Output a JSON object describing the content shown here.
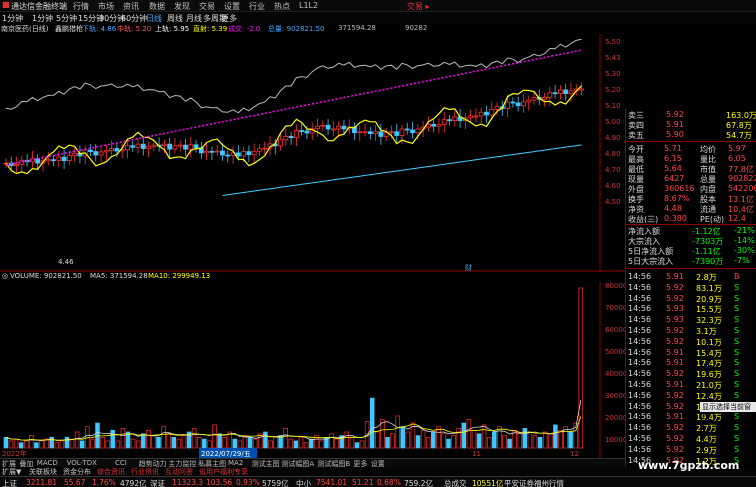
{
  "app": {
    "title": "通达信金融终端",
    "menus": [
      "行情",
      "市场",
      "资讯",
      "数据",
      "发现",
      "交易",
      "设置",
      "行业",
      "热点",
      "L1L2"
    ],
    "trade_label": "交易 ▸"
  },
  "periods": [
    "1分钟",
    "1分钟",
    "5分钟",
    "15分钟",
    "30分钟",
    "60分钟",
    "日线",
    "周线",
    "月线",
    "多周期",
    "更多"
  ],
  "active_period": "日线",
  "stock_info": {
    "name_label": "南京医药(日线)",
    "indicator": "鑫鹏猎枪",
    "down_label": "下轨: 4.86",
    "mid_label": "中轨: 5.20",
    "up_label": "上轨: 5.95",
    "price_label": "直射: 5.39",
    "ratio_label": "成交: -2.0",
    "vol_label": "总量: 902821.50",
    "ma5_label": "371594.28",
    "ma10_label": "90282"
  },
  "main_chart": {
    "price_ticks": [
      "5.50",
      "5.43",
      "5.30",
      "5.20",
      "5.10",
      "5.00",
      "4.90",
      "4.80",
      "4.70",
      "4.60",
      "4.50"
    ],
    "low_marker": "4.46",
    "flag_marker": "财"
  },
  "volume_info": {
    "label": "VOLUME: 902821.50",
    "ma5": "MA5: 371594.28",
    "ma10": "MA10: 299949.13"
  },
  "volume_ticks": [
    "80000",
    "70000",
    "60000",
    "50000",
    "40000",
    "30000",
    "20000",
    "10000"
  ],
  "date_labels": {
    "year": "2022年",
    "date": "2022/07/29/五",
    "month_a": "11",
    "month_b": "12"
  },
  "chart_data": {
    "type": "bar",
    "title": "",
    "series": [
      {
        "name": "VOLUME",
        "values": [
          6,
          4,
          5,
          3,
          4,
          7,
          3,
          4,
          5,
          6,
          3,
          4,
          6,
          5,
          9,
          4,
          12,
          5,
          14,
          6,
          4,
          10,
          4,
          11,
          9,
          5,
          4,
          8,
          10,
          7,
          6,
          12,
          8,
          6,
          5,
          7,
          9,
          11,
          6,
          5,
          4,
          13,
          8,
          6,
          9,
          5,
          4,
          7,
          6,
          5,
          8,
          9,
          4,
          6,
          7,
          11,
          5,
          4,
          6,
          3,
          5,
          7,
          4,
          6,
          8,
          5,
          7,
          9,
          6,
          3,
          4,
          15,
          28,
          9,
          16,
          6,
          8,
          18,
          12,
          9,
          14,
          7,
          10,
          6,
          9,
          12,
          8,
          5,
          7,
          11,
          14,
          16,
          10,
          8,
          13,
          6,
          9,
          12,
          7,
          5,
          10,
          8,
          11,
          9,
          7,
          6,
          9,
          8,
          13,
          10,
          12,
          9,
          14,
          90
        ]
      }
    ],
    "ylim": [
      0,
      90000
    ]
  },
  "order_book": [
    {
      "label": "卖三",
      "price": "5.92",
      "vol": "163.0万"
    },
    {
      "label": "卖四",
      "price": "5.91",
      "vol": "67.8万"
    },
    {
      "label": "卖五",
      "price": "5.90",
      "vol": "54.7万"
    }
  ],
  "quote_table": [
    {
      "l1": "今开",
      "v1": "5.71",
      "l2": "均价",
      "v2": "5.97"
    },
    {
      "l1": "最高",
      "v1": "6.15",
      "l2": "量比",
      "v2": "6.05"
    },
    {
      "l1": "最低",
      "v1": "5.64",
      "l2": "市值",
      "v2": "77.8亿"
    },
    {
      "l1": "现量",
      "v1": "6427",
      "l2": "总量",
      "v2": "902822"
    },
    {
      "l1": "外盘",
      "v1": "360616",
      "l2": "内盘",
      "v2": "542206"
    },
    {
      "l1": "换手",
      "v1": "8.67%",
      "l2": "股本",
      "v2": "13.1亿"
    },
    {
      "l1": "净资",
      "v1": "4.48",
      "l2": "流通",
      "v2": "10.4亿"
    },
    {
      "l1": "收益(三)",
      "v1": "0.380",
      "l2": "PE(动)",
      "v2": "12.4"
    }
  ],
  "fund_flow": [
    {
      "label": "净流入额",
      "value": "-1.12亿",
      "pct": "-21%"
    },
    {
      "label": "大宗流入",
      "value": "-7303万",
      "pct": "-14%"
    },
    {
      "label": "5日净流入额",
      "value": "-1.11亿",
      "pct": "-30%"
    },
    {
      "label": "5日大宗流入",
      "value": "-7390万",
      "pct": "-7%"
    }
  ],
  "ticks": [
    {
      "time": "14:56",
      "price": "5.91",
      "vol": "2.8万",
      "dir": "B"
    },
    {
      "time": "14:56",
      "price": "5.92",
      "vol": "83.1万",
      "dir": "S"
    },
    {
      "time": "14:56",
      "price": "5.92",
      "vol": "20.9万",
      "dir": "S"
    },
    {
      "time": "14:56",
      "price": "5.93",
      "vol": "15.5万",
      "dir": "S"
    },
    {
      "time": "14:56",
      "price": "5.93",
      "vol": "32.3万",
      "dir": "S"
    },
    {
      "time": "14:56",
      "price": "5.92",
      "vol": "3.1万",
      "dir": "S"
    },
    {
      "time": "14:56",
      "price": "5.92",
      "vol": "10.1万",
      "dir": "S"
    },
    {
      "time": "14:56",
      "price": "5.91",
      "vol": "15.4万",
      "dir": "S"
    },
    {
      "time": "14:56",
      "price": "5.91",
      "vol": "17.4万",
      "dir": "S"
    },
    {
      "time": "14:56",
      "price": "5.92",
      "vol": "19.6万",
      "dir": "S"
    },
    {
      "time": "14:56",
      "price": "5.91",
      "vol": "21.0万",
      "dir": "S"
    },
    {
      "time": "14:56",
      "price": "5.92",
      "vol": "12.4万",
      "dir": "S"
    },
    {
      "time": "14:56",
      "price": "5.92",
      "vol": "17.7万",
      "dir": "S"
    },
    {
      "time": "14:56",
      "price": "5.91",
      "vol": "19.4万",
      "dir": "S"
    },
    {
      "time": "14:56",
      "price": "5.92",
      "vol": "2.7万",
      "dir": "S"
    },
    {
      "time": "14:56",
      "price": "5.92",
      "vol": "4.4万",
      "dir": "S"
    },
    {
      "time": "14:56",
      "price": "5.92",
      "vol": "2.9万",
      "dir": "S"
    },
    {
      "time": "14:56",
      "price": "5.92",
      "vol": "1.2万",
      "dir": "S"
    }
  ],
  "bottom_tabs": [
    "扩展",
    "叠加",
    "MACD",
    "VOL-TDX",
    "CCI",
    "趋势动力",
    "主力监控",
    "私募主图",
    "MA2",
    "测试主图",
    "测试幅图A",
    "测试幅图B",
    "更多",
    "设置"
  ],
  "bottom_tabs2": [
    "扩展▼",
    "关联板块",
    "资金分布",
    "综合资讯",
    "行业资讯",
    "互动问答",
    "省用户福利专享"
  ],
  "status": {
    "sh_label": "上证",
    "sh_val": "3211.81",
    "sh_chg": "55.67",
    "sh_pct": "1.76%",
    "sh_amt": "4792亿",
    "sz_label": "深证",
    "sz_val": "11323.3",
    "sz_chg": "103.56",
    "sz_pct": "0.93%",
    "sz_amt": "5759亿",
    "zx_label": "中小",
    "zx_val": "7541.01",
    "zx_chg": "51.21",
    "zx_pct": "0.68%",
    "zx_amt": "759.2亿",
    "zc_label": "总成交",
    "zc_amt": "10551亿",
    "broker": "平安证券福州行情"
  },
  "watermark": "www.7gpzb.com",
  "tip": "显示选择当前窗口"
}
